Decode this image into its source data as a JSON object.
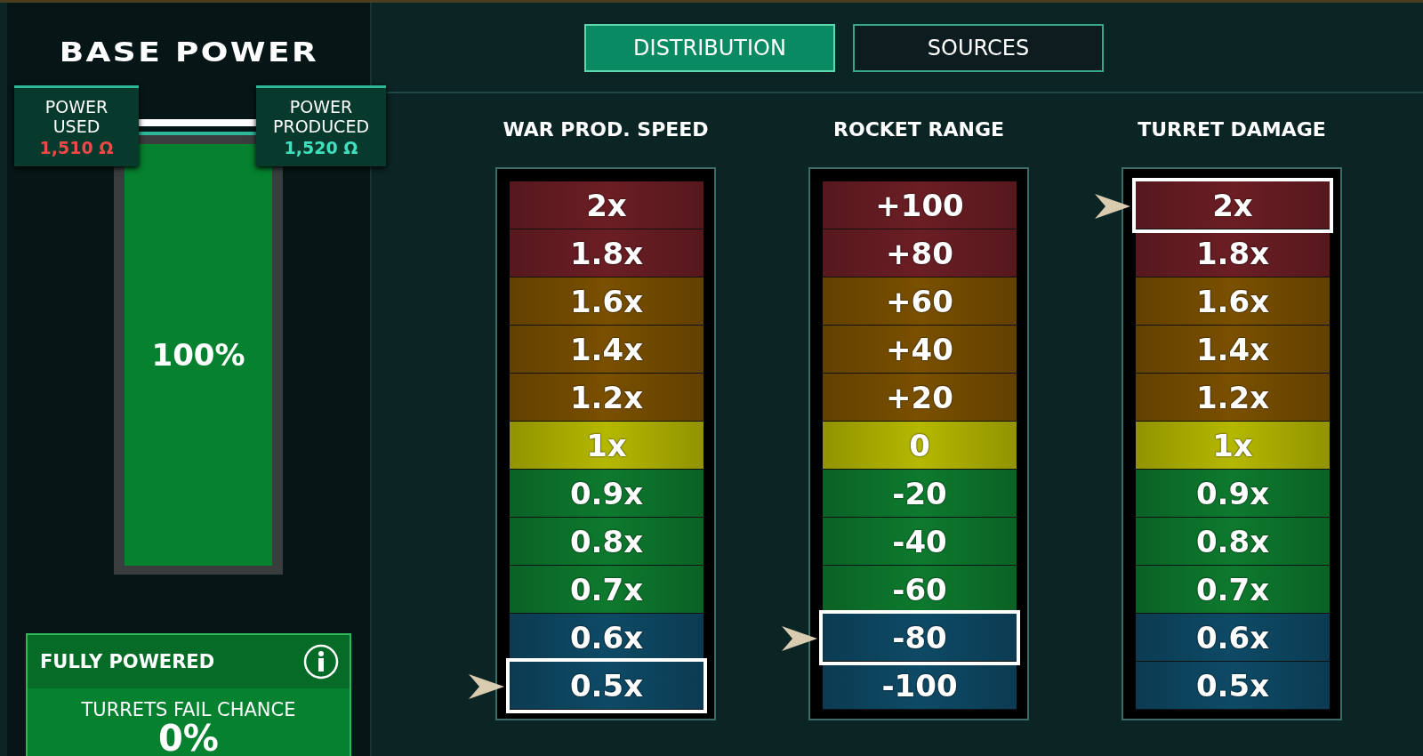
{
  "left_panel": {
    "title": "BASE POWER",
    "power_used": {
      "label": "POWER USED",
      "value": "1,510 Ω"
    },
    "power_produced": {
      "label": "POWER PRODUCED",
      "value": "1,520 Ω"
    },
    "power_bar": {
      "level": 1.0,
      "reading": "100%"
    },
    "status_card": {
      "title": "FULLY POWERED",
      "subtitle": "TURRETS FAIL CHANCE",
      "value": "0%"
    }
  },
  "tabs": [
    {
      "label": "DISTRIBUTION",
      "selected": true
    },
    {
      "label": "SOURCES",
      "selected": false
    }
  ],
  "columns": [
    {
      "title": "WAR PROD. SPEED",
      "rows": [
        {
          "label": "2x",
          "color": "#6b1e24",
          "selected": false
        },
        {
          "label": "1.8x",
          "color": "#6b1e24",
          "selected": false
        },
        {
          "label": "1.6x",
          "color": "#7a5000",
          "selected": false
        },
        {
          "label": "1.4x",
          "color": "#7a5000",
          "selected": false
        },
        {
          "label": "1.2x",
          "color": "#7a5000",
          "selected": false
        },
        {
          "label": "1x",
          "color": "#b5b800",
          "selected": false
        },
        {
          "label": "0.9x",
          "color": "#0d7a2e",
          "selected": false
        },
        {
          "label": "0.8x",
          "color": "#0d7a2e",
          "selected": false
        },
        {
          "label": "0.7x",
          "color": "#0d7a2e",
          "selected": false
        },
        {
          "label": "0.6x",
          "color": "#0e4a66",
          "selected": false
        },
        {
          "label": "0.5x",
          "color": "#0e4a66",
          "selected": true
        }
      ]
    },
    {
      "title": "ROCKET RANGE",
      "rows": [
        {
          "label": "+100",
          "color": "#6b1e24",
          "selected": false
        },
        {
          "label": "+80",
          "color": "#6b1e24",
          "selected": false
        },
        {
          "label": "+60",
          "color": "#7a5000",
          "selected": false
        },
        {
          "label": "+40",
          "color": "#7a5000",
          "selected": false
        },
        {
          "label": "+20",
          "color": "#7a5000",
          "selected": false
        },
        {
          "label": "0",
          "color": "#b5b800",
          "selected": false
        },
        {
          "label": "-20",
          "color": "#0d7a2e",
          "selected": false
        },
        {
          "label": "-40",
          "color": "#0d7a2e",
          "selected": false
        },
        {
          "label": "-60",
          "color": "#0d7a2e",
          "selected": false
        },
        {
          "label": "-80",
          "color": "#0e4a66",
          "selected": true
        },
        {
          "label": "-100",
          "color": "#0e4a66",
          "selected": false
        }
      ]
    },
    {
      "title": "TURRET DAMAGE",
      "rows": [
        {
          "label": "2x",
          "color": "#6b1e24",
          "selected": true
        },
        {
          "label": "1.8x",
          "color": "#6b1e24",
          "selected": false
        },
        {
          "label": "1.6x",
          "color": "#7a5000",
          "selected": false
        },
        {
          "label": "1.4x",
          "color": "#7a5000",
          "selected": false
        },
        {
          "label": "1.2x",
          "color": "#7a5000",
          "selected": false
        },
        {
          "label": "1x",
          "color": "#b5b800",
          "selected": false
        },
        {
          "label": "0.9x",
          "color": "#0d7a2e",
          "selected": false
        },
        {
          "label": "0.8x",
          "color": "#0d7a2e",
          "selected": false
        },
        {
          "label": "0.7x",
          "color": "#0d7a2e",
          "selected": false
        },
        {
          "label": "0.6x",
          "color": "#0e4a66",
          "selected": false
        },
        {
          "label": "0.5x",
          "color": "#0e4a66",
          "selected": false
        }
      ]
    }
  ]
}
